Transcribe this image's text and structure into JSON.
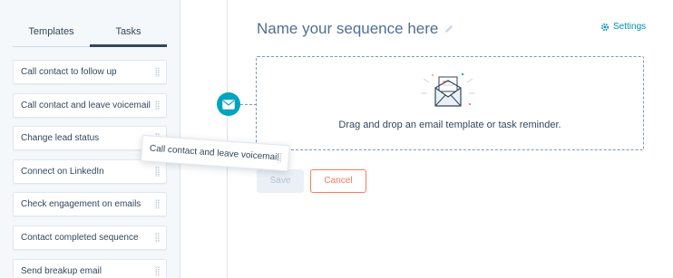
{
  "sidebar": {
    "tabs": [
      {
        "label": "Templates"
      },
      {
        "label": "Tasks"
      }
    ],
    "tasks": [
      {
        "label": "Call contact to follow up"
      },
      {
        "label": "Call contact and leave voicemail"
      },
      {
        "label": "Change lead status"
      },
      {
        "label": "Connect on LinkedIn"
      },
      {
        "label": "Check engagement on emails"
      },
      {
        "label": "Contact completed sequence"
      },
      {
        "label": "Send breakup email"
      }
    ]
  },
  "main": {
    "title": "Name your sequence here",
    "settings_label": "Settings",
    "dropzone_text": "Drag and drop an email template or task reminder.",
    "save_label": "Save",
    "cancel_label": "Cancel"
  },
  "dragging": {
    "label": "Call contact and leave voicemail"
  },
  "colors": {
    "accent": "#00a4bd",
    "link": "#0091ae",
    "cancel": "#ff7a59",
    "text": "#33475b"
  },
  "icons": [
    "pencil-icon",
    "gear-icon",
    "envelope-icon",
    "drag-handle-icon"
  ]
}
